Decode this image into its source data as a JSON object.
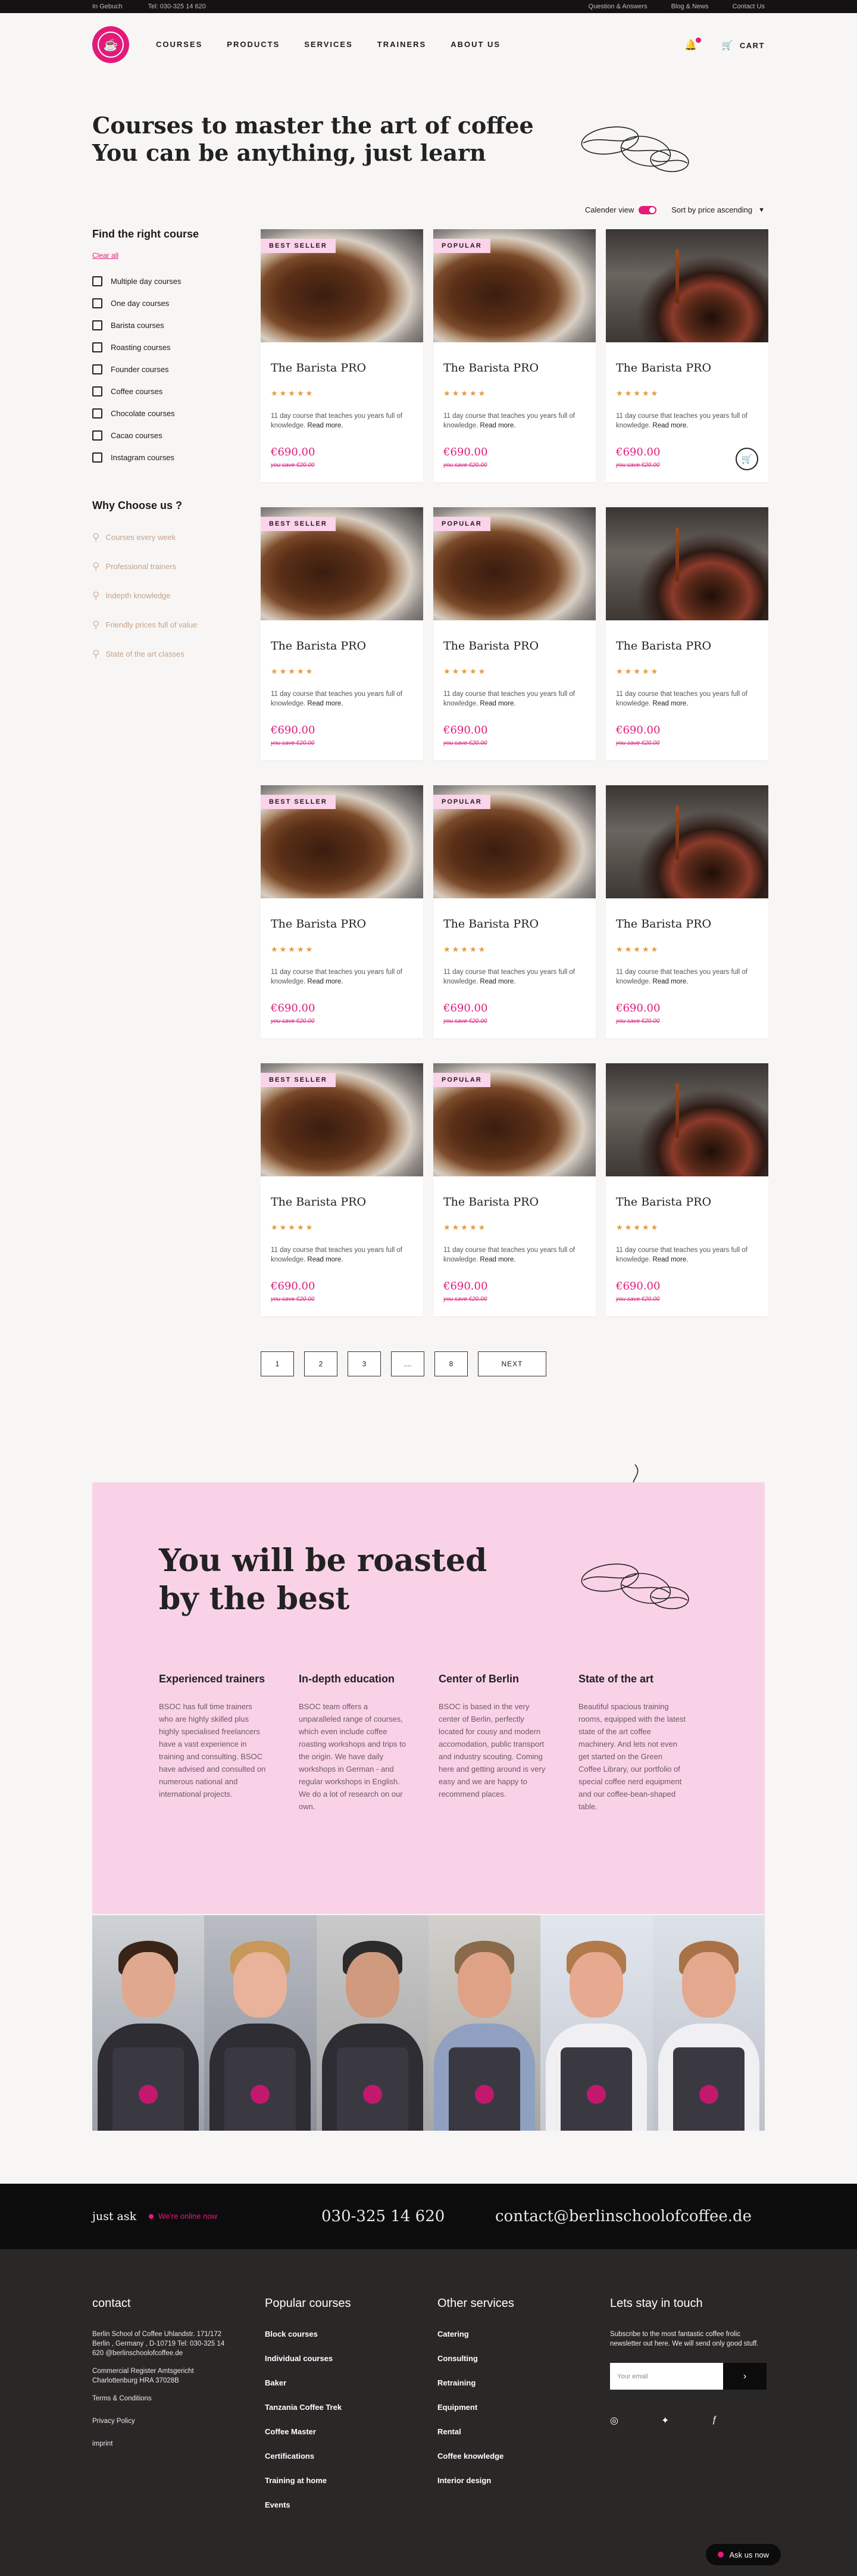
{
  "topbar": {
    "left": [
      "In Gebuch",
      "Tel: 030-325 14 620"
    ],
    "right": [
      "Question & Answers",
      "Blog & News",
      "Contact Us"
    ]
  },
  "nav": {
    "items": [
      "COURSES",
      "PRODUCTS",
      "SERVICES",
      "TRAINERS",
      "ABOUT US"
    ],
    "cart": "CART"
  },
  "hero": {
    "line1": "Courses to master the art of coffee",
    "line2": "You can be anything, just learn"
  },
  "filters": {
    "title": "Find the right course",
    "clear": "Clear all",
    "options": [
      "Multiple day courses",
      "One day courses",
      "Barista courses",
      "Roasting courses",
      "Founder courses",
      "Coffee courses",
      "Chocolate courses",
      "Cacao courses",
      "Instagram courses"
    ]
  },
  "why": {
    "title": "Why Choose us ?",
    "items": [
      "Courses every week",
      "Professional trainers",
      "Indepth knowledge",
      "Friendly prices full of value",
      "State of the art classes"
    ]
  },
  "controls": {
    "calendar": "Calender view",
    "sort": "Sort by price ascending"
  },
  "cards": [
    {
      "badge": "BEST SELLER",
      "title": "The Barista PRO",
      "stars": "★★★★★",
      "desc": "11 day course that teaches you years full of knowledge.",
      "more": "Read more.",
      "price": "€690.00",
      "old": "you save €20.00"
    },
    {
      "badge": "POPULAR",
      "title": "The Barista PRO",
      "stars": "★★★★★",
      "desc": "11 day course that teaches you years full of knowledge.",
      "more": "Read more.",
      "price": "€690.00",
      "old": "you save €20.00"
    },
    {
      "badge": "",
      "title": "The Barista PRO",
      "stars": "★★★★★",
      "desc": "11 day course that teaches you years full of knowledge.",
      "more": "Read more.",
      "price": "€690.00",
      "old": "you save €20.00"
    },
    {
      "badge": "BEST SELLER",
      "title": "The Barista PRO",
      "stars": "★★★★★",
      "desc": "11 day course that teaches you years full of knowledge.",
      "more": "Read more.",
      "price": "€690.00",
      "old": "you save €20.00"
    },
    {
      "badge": "POPULAR",
      "title": "The Barista PRO",
      "stars": "★★★★★",
      "desc": "11 day course that teaches you years full of knowledge.",
      "more": "Read more.",
      "price": "€690.00",
      "old": "you save €20.00"
    },
    {
      "badge": "",
      "title": "The Barista PRO",
      "stars": "★★★★★",
      "desc": "11 day course that teaches you years full of knowledge.",
      "more": "Read more.",
      "price": "€690.00",
      "old": "you save €20.00"
    },
    {
      "badge": "BEST SELLER",
      "title": "The Barista PRO",
      "stars": "★★★★★",
      "desc": "11 day course that teaches you years full of knowledge.",
      "more": "Read more.",
      "price": "€690.00",
      "old": "you save €20.00"
    },
    {
      "badge": "POPULAR",
      "title": "The Barista PRO",
      "stars": "★★★★★",
      "desc": "11 day course that teaches you years full of knowledge.",
      "more": "Read more.",
      "price": "€690.00",
      "old": "you save €20.00"
    },
    {
      "badge": "",
      "title": "The Barista PRO",
      "stars": "★★★★★",
      "desc": "11 day course that teaches you years full of knowledge.",
      "more": "Read more.",
      "price": "€690.00",
      "old": "you save €20.00"
    },
    {
      "badge": "BEST SELLER",
      "title": "The Barista PRO",
      "stars": "★★★★★",
      "desc": "11 day course that teaches you years full of knowledge.",
      "more": "Read more.",
      "price": "€690.00",
      "old": "you save €20.00"
    },
    {
      "badge": "POPULAR",
      "title": "The Barista PRO",
      "stars": "★★★★★",
      "desc": "11 day course that teaches you years full of knowledge.",
      "more": "Read more.",
      "price": "€690.00",
      "old": "you save €20.00"
    },
    {
      "badge": "",
      "title": "The Barista PRO",
      "stars": "★★★★★",
      "desc": "11 day course that teaches you years full of knowledge.",
      "more": "Read more.",
      "price": "€690.00",
      "old": "you save €20.00"
    }
  ],
  "pager": [
    "1",
    "2",
    "3",
    "....",
    "8",
    "NEXT"
  ],
  "pink": {
    "line1": "You will be roasted",
    "line2": "by the best",
    "cols": [
      {
        "title": "Experienced trainers",
        "text": "BSOC has full time trainers who are highly skilled plus highly specialised freelancers have a vast experience in training and consulting. BSOC have advised and consulted on numerous national and international projects."
      },
      {
        "title": "In-depth education",
        "text": "BSOC team offers a unparalleled range of courses, which even include coffee roasting workshops and trips to the origin. We have daily workshops in German - and regular workshops in English. We do a lot of research on our own."
      },
      {
        "title": "Center of Berlin",
        "text": "BSOC is based in the very center of Berlin, perfectly located for cousy and modern accomodation, public transport and industry scouting. Coming here and getting around is very easy and we are happy to recommend places."
      },
      {
        "title": "State of the art",
        "text": "Beautiful spacious training rooms, equipped with the latest state of the art coffee machinery. And lets not even get started on the Green Coffee Library, our portfolio of special coffee nerd equipment and our coffee-bean-shaped table."
      }
    ]
  },
  "contact": {
    "ask": "just ask",
    "online": "We're online now",
    "phone": "030-325 14 620",
    "email": "contact@berlinschoolofcoffee.de"
  },
  "footer": {
    "contact_title": "contact",
    "address": [
      "Berlin School of Coffee Uhlandstr. 171/172",
      "Berlin , Germany , D-10719 Tel: 030-325 14",
      "620 @berlinschoolofcoffee.de"
    ],
    "register": [
      "Commercial Register Amtsgericht",
      "Charlottenburg HRA 37028B"
    ],
    "links": [
      "Terms & Conditions",
      "Privacy Policy",
      "imprint"
    ],
    "popular_title": "Popular courses",
    "popular": [
      "Block courses",
      "Individual courses",
      "Baker",
      "Tanzania Coffee Trek",
      "Coffee Master",
      "Certifications",
      "Training at home",
      "Events"
    ],
    "services_title": "Other services",
    "services": [
      "Catering",
      "Consulting",
      "Retraining",
      "Equipment",
      "Rental",
      "Coffee knowledge",
      "Interior design"
    ],
    "news_title": "Lets stay in touch",
    "news_text": "Subscribe to the most fantastic coffee frolic newsletter out here. We will send only good stuff.",
    "email_placeholder": "Your email",
    "ask_btn": "Ask us now"
  },
  "colors": {
    "accent": "#e21b7a",
    "pink_bg": "#fad2e7",
    "dark": "#0d0c0c"
  }
}
